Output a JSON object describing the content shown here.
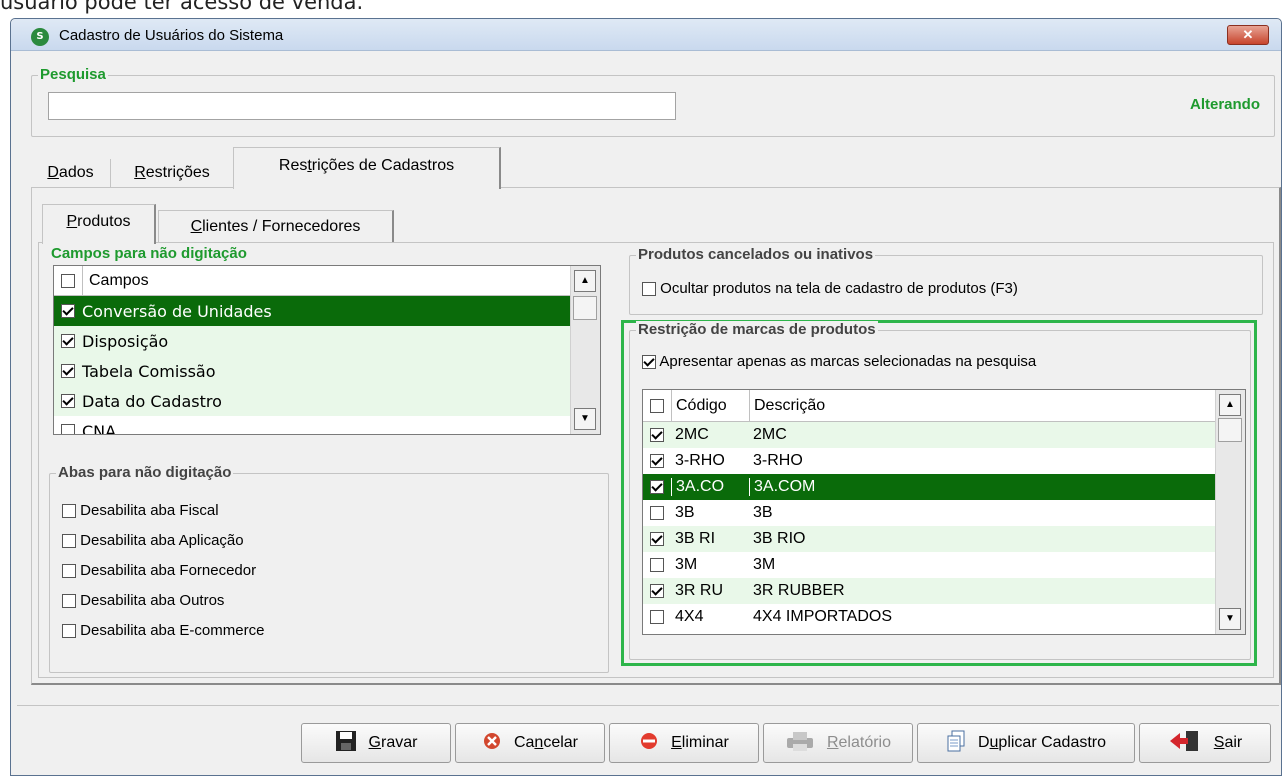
{
  "caption": "usuário pode ter acesso de venda.",
  "window": {
    "title": "Cadastro de Usuários do Sistema",
    "close": "✕",
    "app_icon": "S"
  },
  "search": {
    "legend": "Pesquisa",
    "value": "",
    "placeholder": "",
    "status": "Alterando"
  },
  "tabs": [
    {
      "pre": "",
      "u": "D",
      "post": "ados"
    },
    {
      "pre": "",
      "u": "R",
      "post": "estrições"
    },
    {
      "pre": "Res",
      "u": "t",
      "post": "rições de Cadastros"
    }
  ],
  "subtabs": [
    {
      "pre": "",
      "u": "P",
      "post": "rodutos"
    },
    {
      "pre": "",
      "u": "C",
      "post": "lientes / Fornecedores"
    }
  ],
  "campos": {
    "legend": "Campos para não digitação",
    "header": "Campos",
    "header_checked": false,
    "items": [
      {
        "label": "Conversão de Unidades",
        "checked": true,
        "selected": true
      },
      {
        "label": "Disposição",
        "checked": true
      },
      {
        "label": "Tabela Comissão",
        "checked": true
      },
      {
        "label": "Data do Cadastro",
        "checked": true
      },
      {
        "label": "CNA",
        "checked": false
      }
    ]
  },
  "abas": {
    "legend": "Abas para não digitação",
    "items": [
      {
        "label": "Desabilita aba Fiscal",
        "checked": false
      },
      {
        "label": "Desabilita aba Aplicação",
        "checked": false
      },
      {
        "label": "Desabilita aba Fornecedor",
        "checked": false
      },
      {
        "label": "Desabilita aba Outros",
        "checked": false
      },
      {
        "label": "Desabilita aba E-commerce",
        "checked": false
      }
    ]
  },
  "cancelados": {
    "legend": "Produtos cancelados ou inativos",
    "option": "Ocultar produtos na tela de cadastro de produtos (F3)",
    "checked": false
  },
  "marcas": {
    "legend": "Restrição de marcas de produtos",
    "option": "Apresentar apenas as marcas selecionadas na pesquisa",
    "option_checked": true,
    "col_codigo": "Código",
    "col_descricao": "Descrição",
    "rows": [
      {
        "codigo": "2MC",
        "descricao": "2MC",
        "checked": true
      },
      {
        "codigo": "3-RHO",
        "descricao": "3-RHO",
        "checked": true
      },
      {
        "codigo": "3A.CO",
        "descricao": "3A.COM",
        "checked": true,
        "selected": true
      },
      {
        "codigo": "3B",
        "descricao": "3B",
        "checked": false
      },
      {
        "codigo": "3B RI",
        "descricao": "3B RIO",
        "checked": true
      },
      {
        "codigo": "3M",
        "descricao": "3M",
        "checked": false
      },
      {
        "codigo": "3R RU",
        "descricao": "3R RUBBER",
        "checked": true
      },
      {
        "codigo": "4X4",
        "descricao": "4X4 IMPORTADOS",
        "checked": false
      }
    ]
  },
  "buttons": [
    {
      "pre": "",
      "u": "G",
      "post": "ravar",
      "icon": "floppy-icon"
    },
    {
      "pre": "Ca",
      "u": "n",
      "post": "celar",
      "icon": "cancel-icon"
    },
    {
      "pre": "",
      "u": "E",
      "post": "liminar",
      "icon": "delete-icon"
    },
    {
      "pre": "",
      "u": "R",
      "post": "elatório",
      "icon": "report-icon",
      "disabled": true
    },
    {
      "pre": "D",
      "u": "u",
      "post": "plicar Cadastro",
      "icon": "duplicate-icon"
    },
    {
      "pre": "",
      "u": "S",
      "post": "air",
      "icon": "exit-icon"
    }
  ],
  "colors": {
    "green_text": "#1e9a2e",
    "selection": "#0a6b0a",
    "row_light": "#e9f8e9",
    "highlight_border": "#2db54a"
  }
}
